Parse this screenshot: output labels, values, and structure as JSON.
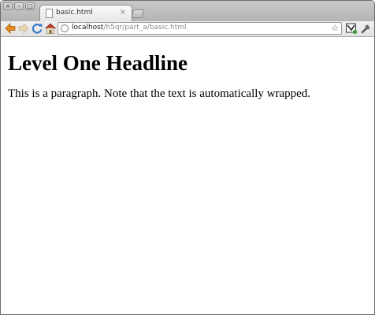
{
  "tab": {
    "title": "basic.html",
    "close_glyph": "×"
  },
  "window_controls": {
    "close_glyph": "×",
    "minimize_glyph": "–",
    "maximize_glyph": "□"
  },
  "address_bar": {
    "host": "localhost",
    "path": "/h5qr/part_a/basic.html"
  },
  "icons": {
    "back": "back-arrow-icon",
    "forward": "forward-arrow-icon",
    "reload": "reload-icon",
    "home": "home-icon",
    "bookmark": "star-icon",
    "page_action": "page-action-icon",
    "wrench": "wrench-icon"
  },
  "colors": {
    "back_arrow": "#e08a1e",
    "reload": "#3a78c8",
    "home_roof": "#c0392b"
  },
  "page": {
    "headline": "Level One Headline",
    "paragraph": "This is a paragraph. Note that the text is automatically wrapped."
  }
}
